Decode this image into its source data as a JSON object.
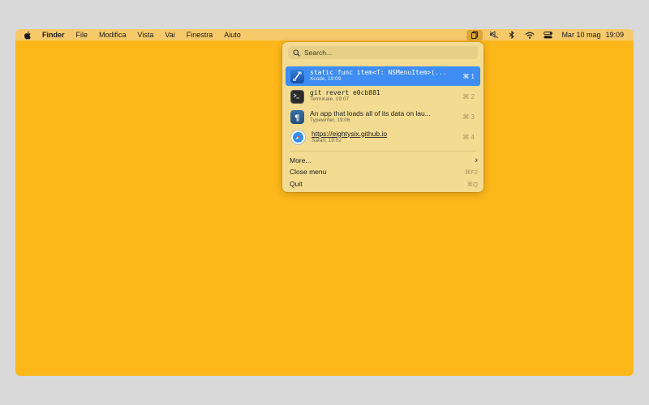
{
  "menubar": {
    "app_name": "Finder",
    "menus": [
      "File",
      "Modifica",
      "Vista",
      "Vai",
      "Finestra",
      "Aiuto"
    ],
    "date": "Mar 10 mag",
    "time": "19:09"
  },
  "popup": {
    "search_placeholder": "Search...",
    "items": [
      {
        "title": "static func item<T: NSMenuItem>(...",
        "subtitle": "Xcode, 19:09",
        "shortcut": "⌘ 1",
        "icon": "xcode-icon",
        "selected": true
      },
      {
        "title": "git revert e0cb881",
        "subtitle": "Terminale, 19:07",
        "shortcut": "⌘ 2",
        "icon": "terminal-icon"
      },
      {
        "title": "An app that loads all of its data on lau...",
        "subtitle": "Typewriter, 19:06",
        "shortcut": "⌘ 3",
        "icon": "typewriter-icon"
      },
      {
        "title": "https://eightysix.github.io",
        "subtitle": "Safari, 19:02",
        "shortcut": "⌘ 4",
        "icon": "safari-icon"
      }
    ],
    "more_label": "More...",
    "more_arrow": "›",
    "close_label": "Close menu",
    "close_shortcut": "⌘F2",
    "quit_label": "Quit",
    "quit_shortcut": "⌘Q"
  },
  "colors": {
    "desktop": "#fdb71a",
    "popup_bg": "#f3db91",
    "selection": "#3e8df2"
  }
}
